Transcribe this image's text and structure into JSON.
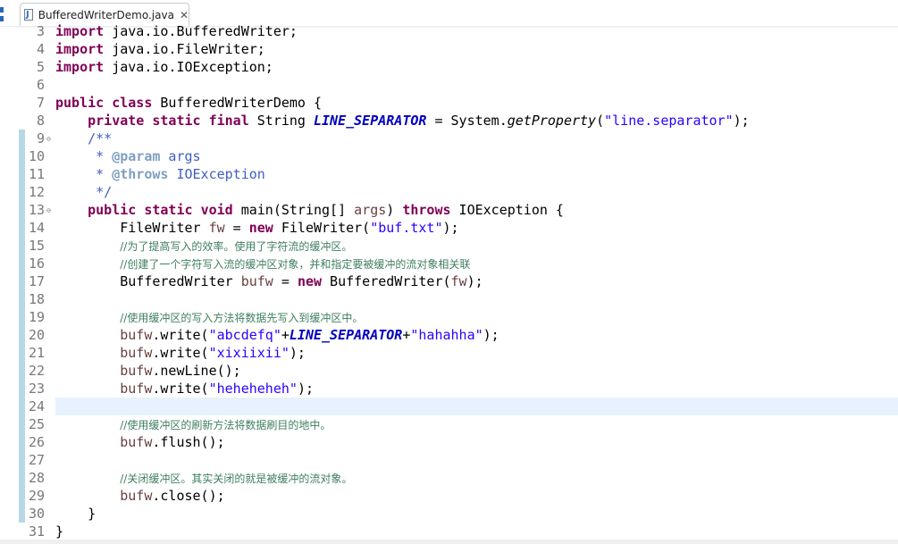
{
  "tab": {
    "filename": "BufferedWriterDemo.java",
    "close_glyph": "✕",
    "icon": "java-file-icon"
  },
  "colors": {
    "keyword": "#7f0055",
    "string": "#2a00ff",
    "comment": "#3f7f5f",
    "javadoc": "#3f5fbf",
    "field": "#0000c0",
    "line_number": "#787878",
    "current_line": "#e8f2fe",
    "change_bar": "#b8d7e6"
  },
  "editor": {
    "current_line": "24",
    "lines": [
      {
        "n": "3",
        "tokens": [
          [
            "kw",
            "import"
          ],
          [
            "t",
            " java.io.BufferedWriter;"
          ]
        ]
      },
      {
        "n": "4",
        "tokens": [
          [
            "kw",
            "import"
          ],
          [
            "t",
            " java.io.FileWriter;"
          ]
        ]
      },
      {
        "n": "5",
        "tokens": [
          [
            "kw",
            "import"
          ],
          [
            "t",
            " java.io.IOException;"
          ]
        ]
      },
      {
        "n": "6",
        "tokens": []
      },
      {
        "n": "7",
        "tokens": [
          [
            "kw",
            "public"
          ],
          [
            "t",
            " "
          ],
          [
            "kw",
            "class"
          ],
          [
            "t",
            " BufferedWriterDemo {"
          ]
        ]
      },
      {
        "n": "8",
        "tokens": [
          [
            "t",
            "    "
          ],
          [
            "kw",
            "private"
          ],
          [
            "t",
            " "
          ],
          [
            "kw",
            "static"
          ],
          [
            "t",
            " "
          ],
          [
            "kw",
            "final"
          ],
          [
            "t",
            " String "
          ],
          [
            "fld",
            "LINE_SEPARATOR"
          ],
          [
            "t",
            " = System."
          ],
          [
            "mth",
            "getProperty"
          ],
          [
            "t",
            "("
          ],
          [
            "str",
            "\"line.separator\""
          ],
          [
            "t",
            ");"
          ]
        ]
      },
      {
        "n": "9",
        "fold": "⊖",
        "tokens": [
          [
            "t",
            "    "
          ],
          [
            "jd",
            "/**"
          ]
        ]
      },
      {
        "n": "10",
        "tokens": [
          [
            "t",
            "     "
          ],
          [
            "jd",
            "* "
          ],
          [
            "jdtag",
            "@param"
          ],
          [
            "jd",
            " args"
          ]
        ]
      },
      {
        "n": "11",
        "tokens": [
          [
            "t",
            "     "
          ],
          [
            "jd",
            "* "
          ],
          [
            "jdtag",
            "@throws"
          ],
          [
            "jd",
            " IOException"
          ]
        ]
      },
      {
        "n": "12",
        "tokens": [
          [
            "t",
            "     "
          ],
          [
            "jd",
            "*/"
          ]
        ]
      },
      {
        "n": "13",
        "fold": "⊖",
        "tokens": [
          [
            "t",
            "    "
          ],
          [
            "kw",
            "public"
          ],
          [
            "t",
            " "
          ],
          [
            "kw",
            "static"
          ],
          [
            "t",
            " "
          ],
          [
            "kw",
            "void"
          ],
          [
            "t",
            " main(String[] "
          ],
          [
            "var",
            "args"
          ],
          [
            "t",
            ") "
          ],
          [
            "kw",
            "throws"
          ],
          [
            "t",
            " IOException {"
          ]
        ]
      },
      {
        "n": "14",
        "tokens": [
          [
            "t",
            "        FileWriter "
          ],
          [
            "var",
            "fw"
          ],
          [
            "t",
            " = "
          ],
          [
            "kw",
            "new"
          ],
          [
            "t",
            " FileWriter("
          ],
          [
            "str",
            "\"buf.txt\""
          ],
          [
            "t",
            ");"
          ]
        ]
      },
      {
        "n": "15",
        "tokens": [
          [
            "t",
            "        "
          ],
          [
            "cm",
            "//为了提高写入的效率。使用了字符流的缓冲区。"
          ]
        ]
      },
      {
        "n": "16",
        "tokens": [
          [
            "t",
            "        "
          ],
          [
            "cm",
            "//创建了一个字符写入流的缓冲区对象，并和指定要被缓冲的流对象相关联"
          ]
        ]
      },
      {
        "n": "17",
        "tokens": [
          [
            "t",
            "        BufferedWriter "
          ],
          [
            "var",
            "bufw"
          ],
          [
            "t",
            " = "
          ],
          [
            "kw",
            "new"
          ],
          [
            "t",
            " BufferedWriter("
          ],
          [
            "var",
            "fw"
          ],
          [
            "t",
            ");"
          ]
        ]
      },
      {
        "n": "18",
        "tokens": []
      },
      {
        "n": "19",
        "tokens": [
          [
            "t",
            "        "
          ],
          [
            "cm",
            "//使用缓冲区的写入方法将数据先写入到缓冲区中。"
          ]
        ]
      },
      {
        "n": "20",
        "tokens": [
          [
            "t",
            "        "
          ],
          [
            "var",
            "bufw"
          ],
          [
            "t",
            ".write("
          ],
          [
            "str",
            "\"abcdefq\""
          ],
          [
            "t",
            "+"
          ],
          [
            "fld",
            "LINE_SEPARATOR"
          ],
          [
            "t",
            "+"
          ],
          [
            "str",
            "\"hahahha\""
          ],
          [
            "t",
            ");"
          ]
        ]
      },
      {
        "n": "21",
        "tokens": [
          [
            "t",
            "        "
          ],
          [
            "var",
            "bufw"
          ],
          [
            "t",
            ".write("
          ],
          [
            "str",
            "\"xixiixii\""
          ],
          [
            "t",
            ");"
          ]
        ]
      },
      {
        "n": "22",
        "tokens": [
          [
            "t",
            "        "
          ],
          [
            "var",
            "bufw"
          ],
          [
            "t",
            ".newLine();"
          ]
        ]
      },
      {
        "n": "23",
        "tokens": [
          [
            "t",
            "        "
          ],
          [
            "var",
            "bufw"
          ],
          [
            "t",
            ".write("
          ],
          [
            "str",
            "\"heheheheh\""
          ],
          [
            "t",
            ");"
          ]
        ]
      },
      {
        "n": "24",
        "tokens": []
      },
      {
        "n": "25",
        "tokens": [
          [
            "t",
            "        "
          ],
          [
            "cm",
            "//使用缓冲区的刷新方法将数据刷目的地中。"
          ]
        ]
      },
      {
        "n": "26",
        "tokens": [
          [
            "t",
            "        "
          ],
          [
            "var",
            "bufw"
          ],
          [
            "t",
            ".flush();"
          ]
        ]
      },
      {
        "n": "27",
        "tokens": []
      },
      {
        "n": "28",
        "tokens": [
          [
            "t",
            "        "
          ],
          [
            "cm",
            "//关闭缓冲区。其实关闭的就是被缓冲的流对象。"
          ]
        ]
      },
      {
        "n": "29",
        "tokens": [
          [
            "t",
            "        "
          ],
          [
            "var",
            "bufw"
          ],
          [
            "t",
            ".close();"
          ]
        ]
      },
      {
        "n": "30",
        "tokens": [
          [
            "t",
            "    }"
          ]
        ]
      },
      {
        "n": "31",
        "tokens": [
          [
            "t",
            "}"
          ]
        ]
      }
    ]
  }
}
